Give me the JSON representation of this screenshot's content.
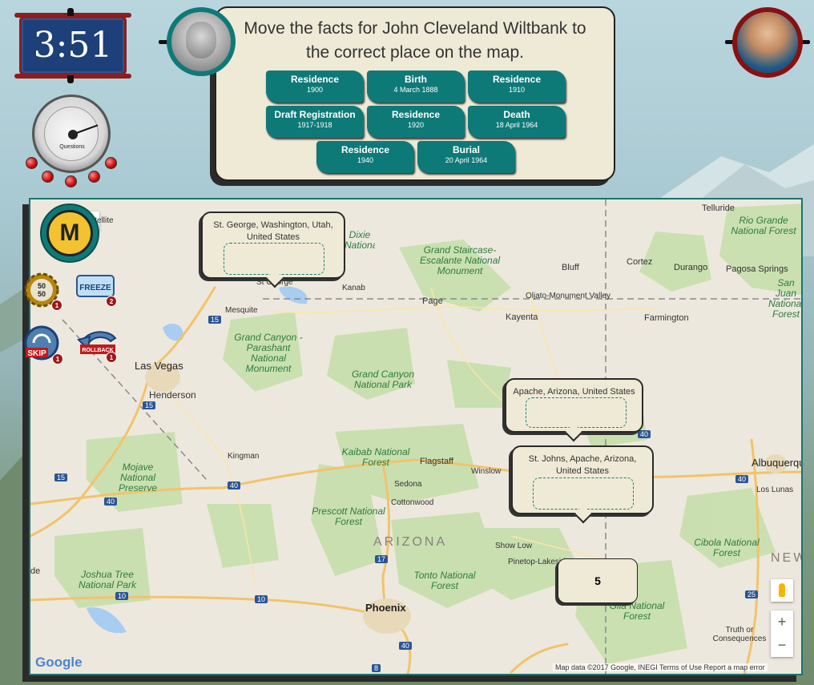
{
  "timer": {
    "value": "3:51"
  },
  "gauge": {
    "label": "Questions"
  },
  "instruction": {
    "line1": "Move the facts for John Cleveland Wiltbank to",
    "line2": "the correct place on the map."
  },
  "facts": [
    {
      "label": "Residence",
      "date": "1900"
    },
    {
      "label": "Birth",
      "date": "4 March 1888"
    },
    {
      "label": "Residence",
      "date": "1910"
    },
    {
      "label": "Draft Registration",
      "date": "1917-1918"
    },
    {
      "label": "Residence",
      "date": "1920"
    },
    {
      "label": "Death",
      "date": "18 April 1964"
    },
    {
      "label": "Residence",
      "date": "1940"
    },
    {
      "label": "Burial",
      "date": "20 April 1964"
    }
  ],
  "lifelines": {
    "mode_badge": "M",
    "fifty_fifty": {
      "label": "50 50",
      "count": "1"
    },
    "freeze": {
      "label": "FREEZE",
      "count": "2"
    },
    "skip": {
      "label": "SKIP",
      "count": "1"
    },
    "rollback": {
      "label": "ROLLBACK",
      "count": "1"
    }
  },
  "map": {
    "satellite_label": "Satellite",
    "places": [
      "Telluride",
      "Cortez",
      "Durango",
      "Pagosa Springs",
      "Bluff",
      "Oljato-Monument Valley",
      "Kayenta",
      "Farmington",
      "Kanab",
      "Page",
      "Mesquite",
      "St George",
      "Henderson",
      "Kingman",
      "Flagstaff",
      "Winslow",
      "Sedona",
      "Cottonwood",
      "Show Low",
      "Pinetop-Lakeside",
      "Los Lunas",
      "Truth or Consequences"
    ],
    "big_cities": {
      "las_vegas": "Las Vegas",
      "phoenix": "Phoenix",
      "albuquerque": "Albuquerque"
    },
    "parks": {
      "rio_grande": "Rio Grande National Forest",
      "san_juan": "San Juan National Forest",
      "grand_staircase": "Grand Staircase-Escalante National Monument",
      "dixie": "Dixie National Forest",
      "parashant": "Grand Canyon - Parashant National Monument",
      "grand_canyon": "Grand Canyon National Park",
      "kaibab": "Kaibab National Forest",
      "mojave": "Mojave National Preserve",
      "prescott": "Prescott National Forest",
      "tonto": "Tonto National Forest",
      "joshua_tree": "Joshua Tree National Park",
      "cibola": "Cibola National Forest",
      "gila": "Gila National Forest"
    },
    "states": {
      "arizona": "ARIZONA",
      "new_mexico": "NEW"
    },
    "highways": [
      "15",
      "15",
      "15",
      "40",
      "40",
      "40",
      "40",
      "17",
      "10",
      "10",
      "25",
      "8",
      "40"
    ],
    "attribution": "Map data ©2017 Google, INEGI   Terms of Use   Report a map error",
    "logo": "Google",
    "edge_text": "de"
  },
  "callouts": [
    {
      "title": "St. George, Washington, Utah, United States"
    },
    {
      "title": "Apache, Arizona, United States"
    },
    {
      "title": "St. Johns, Apache, Arizona, United States"
    }
  ],
  "score_box": {
    "value": "5"
  },
  "zoom": {
    "in": "+",
    "out": "−"
  }
}
